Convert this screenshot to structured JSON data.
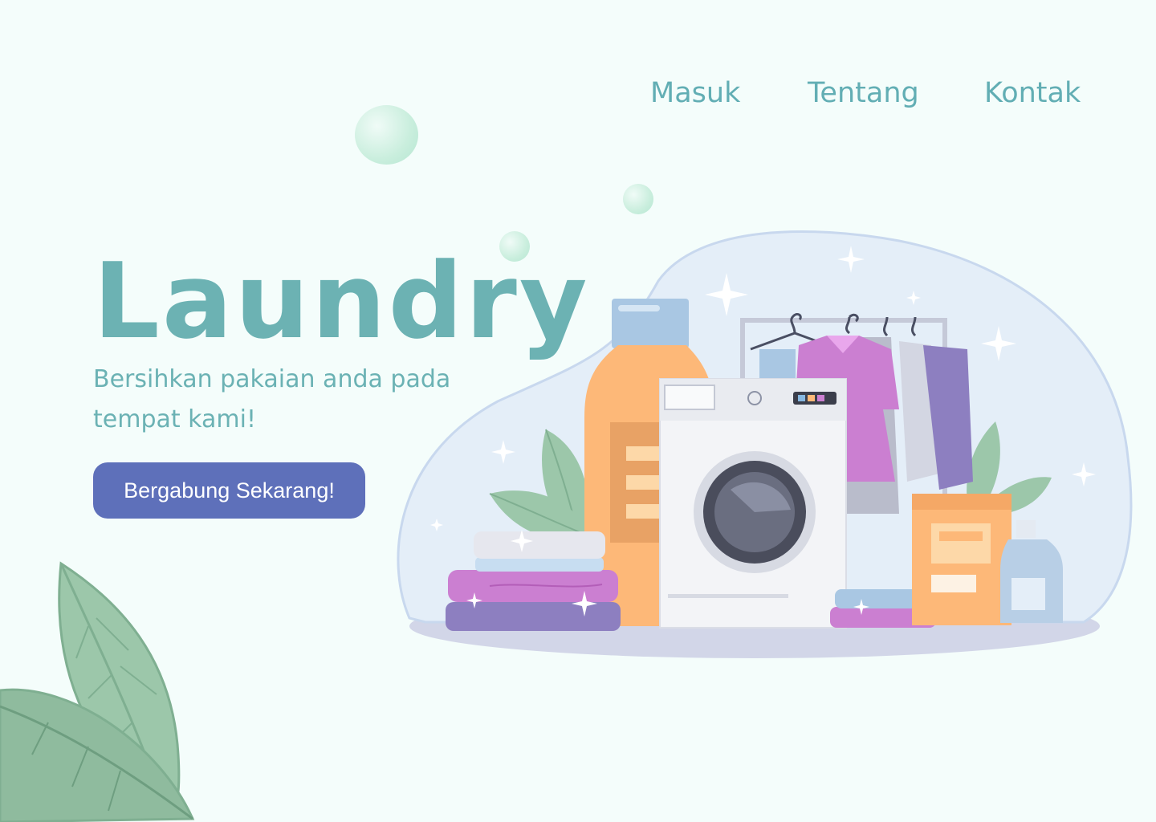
{
  "nav": {
    "items": [
      {
        "label": "Masuk"
      },
      {
        "label": "Tentang"
      },
      {
        "label": "Kontak"
      }
    ]
  },
  "hero": {
    "title": "Laundry",
    "subtitle": "Bersihkan pakaian anda pada tempat kami!",
    "cta_label": "Bergabung Sekarang!"
  },
  "colors": {
    "background": "#F4FDFB",
    "accent_teal": "#6CB2B3",
    "button": "#5E70BA",
    "button_text": "#FFFFFF"
  },
  "icons": [
    "bubble-icon",
    "leaf-icon",
    "sparkle-icon",
    "washing-machine-icon",
    "detergent-bottle-icon",
    "clothes-rack-icon",
    "folded-towels-icon",
    "soap-box-icon"
  ]
}
